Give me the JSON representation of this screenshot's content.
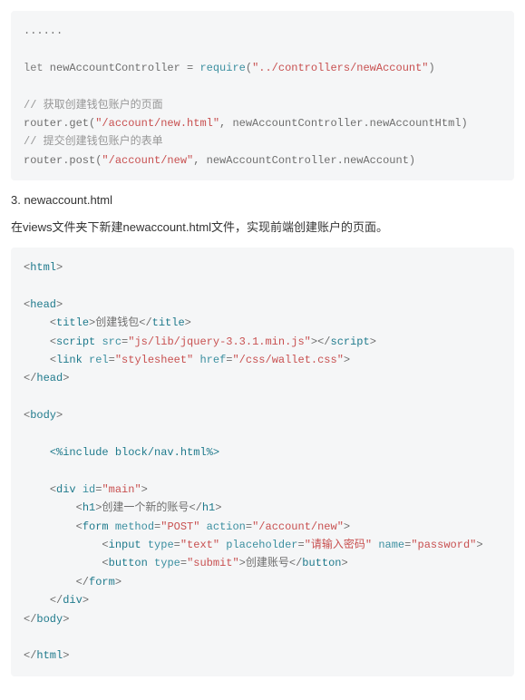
{
  "block1": {
    "l0": "......",
    "l1_a": "let",
    "l1_b": " newAccountController = ",
    "l1_c": "require",
    "l1_d": "(",
    "l1_e": "\"../controllers/newAccount\"",
    "l1_f": ")",
    "l2": "// 获取创建钱包账户的页面",
    "l3_a": "router.get(",
    "l3_b": "\"/account/new.html\"",
    "l3_c": ", newAccountController.newAccountHtml)",
    "l4": "// 提交创建钱包账户的表单",
    "l5_a": "router.post(",
    "l5_b": "\"/account/new\"",
    "l5_c": ", newAccountController.newAccount)"
  },
  "section": {
    "title": "3. newaccount.html",
    "desc": "在views文件夹下新建newaccount.html文件，实现前端创建账户的页面。"
  },
  "block2": {
    "html_open": "html",
    "head_open": "head",
    "title_open": "title",
    "title_text": "创建钱包",
    "title_close": "title",
    "script_open": "script",
    "script_src_attr": "src",
    "script_src_val": "\"js/lib/jquery-3.3.1.min.js\"",
    "script_close": "script",
    "link_open": "link",
    "link_rel_attr": "rel",
    "link_rel_val": "\"stylesheet\"",
    "link_href_attr": "href",
    "link_href_val": "\"/css/wallet.css\"",
    "head_close": "head",
    "body_open": "body",
    "include_line": "<%include block/nav.html%>",
    "div_open": "div",
    "div_id_attr": "id",
    "div_id_val": "\"main\"",
    "h1_open": "h1",
    "h1_text": "创建一个新的账号",
    "h1_close": "h1",
    "form_open": "form",
    "form_method_attr": "method",
    "form_method_val": "\"POST\"",
    "form_action_attr": "action",
    "form_action_val": "\"/account/new\"",
    "input_open": "input",
    "input_type_attr": "type",
    "input_type_val": "\"text\"",
    "input_ph_attr": "placeholder",
    "input_ph_val": "\"请输入密码\"",
    "input_name_attr": "name",
    "input_name_val": "\"password\"",
    "button_open": "button",
    "button_type_attr": "type",
    "button_type_val": "\"submit\"",
    "button_text": "创建账号",
    "button_close": "button",
    "form_close": "form",
    "div_close": "div",
    "body_close": "body",
    "html_close": "html"
  }
}
